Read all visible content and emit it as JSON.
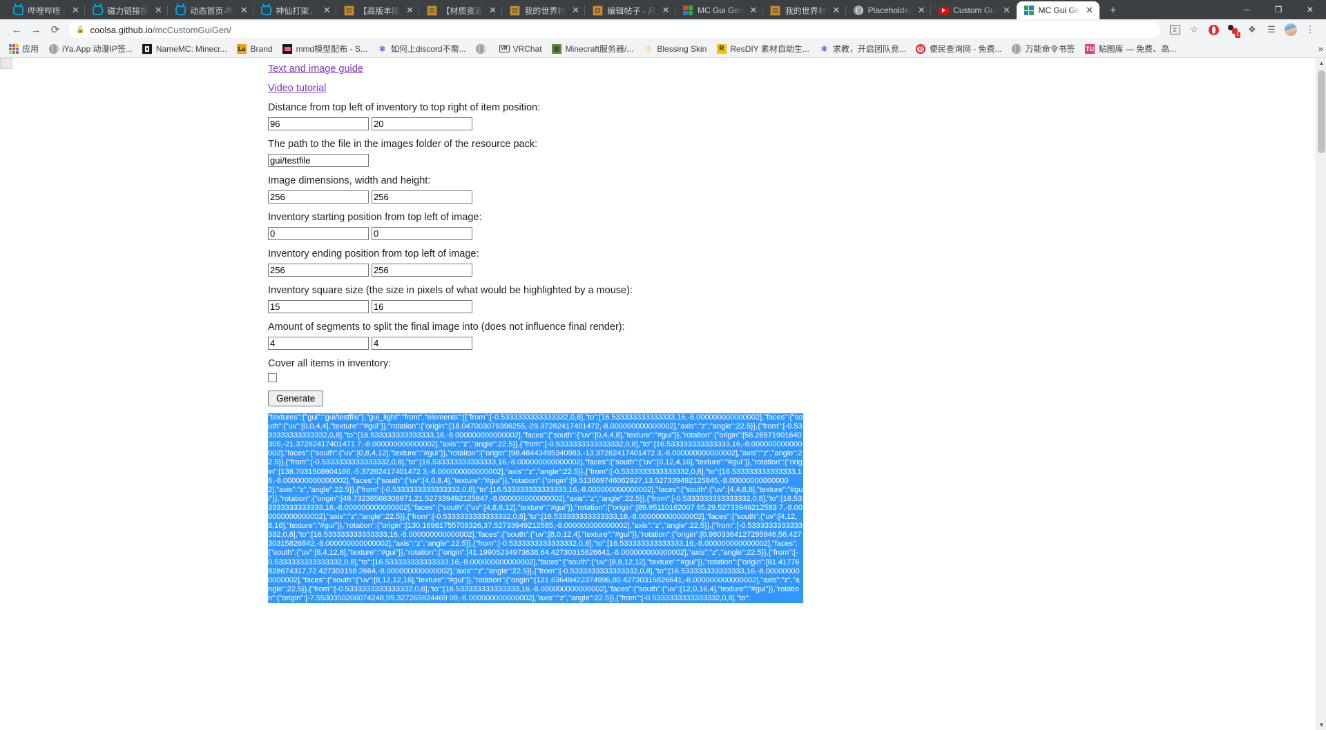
{
  "browser": {
    "tabs": [
      {
        "title": "哔哩哔哩 (",
        "icon": "bilibili-icon",
        "active": false
      },
      {
        "title": "磁力链接搜",
        "icon": "bilibili-icon",
        "active": false
      },
      {
        "title": "动态首页-哔",
        "icon": "bilibili-icon",
        "active": false
      },
      {
        "title": "神仙打架，",
        "icon": "bilibili-icon",
        "active": false
      },
      {
        "title": "【高版本随",
        "icon": "minecraft-crate-icon",
        "active": false
      },
      {
        "title": "【材质资源",
        "icon": "minecraft-crate-icon",
        "active": false
      },
      {
        "title": "我的世界材",
        "icon": "minecraft-crate-icon",
        "active": false
      },
      {
        "title": "编辑帖子 - 月",
        "icon": "minecraft-crate-icon",
        "active": false
      },
      {
        "title": "MC Gui Gen",
        "icon": "mcgui-icon",
        "active": false
      },
      {
        "title": "我的世界材",
        "icon": "minecraft-crate-icon",
        "active": false
      },
      {
        "title": "Placeholder",
        "icon": "globe-icon",
        "active": false
      },
      {
        "title": "Custom Gui",
        "icon": "youtube-icon",
        "active": false
      },
      {
        "title": "MC Gui Ge",
        "icon": "mcgui-icon",
        "active": true
      }
    ],
    "new_tab_label": "+",
    "window_controls": {
      "minimize": "─",
      "maximize": "❐",
      "close": "✕"
    },
    "nav": {
      "back": "←",
      "forward": "→",
      "reload": "⟳"
    },
    "omnibox": {
      "lock_icon": "lock-icon",
      "url_domain": "coolsa.github.io",
      "url_path": "/mcCustomGuiGen/"
    },
    "toolbar_icons": [
      {
        "name": "translate-icon",
        "glyph": "文"
      },
      {
        "name": "bookmark-star-icon",
        "glyph": "☆"
      },
      {
        "name": "opera-extension-icon",
        "glyph": ""
      },
      {
        "name": "adblock-icon",
        "glyph": "",
        "badge": "2"
      },
      {
        "name": "extensions-puzzle-icon",
        "glyph": "❖"
      },
      {
        "name": "playlist-icon",
        "glyph": "☰"
      },
      {
        "name": "profile-avatar",
        "glyph": ""
      },
      {
        "name": "chrome-menu-icon",
        "glyph": "⋮"
      }
    ],
    "bookmarks": [
      {
        "label": "应用",
        "icon": "apps-grid-icon"
      },
      {
        "label": "iYa.App 动漫IP签...",
        "icon": "globe-icon"
      },
      {
        "label": "NameMC: Minecr...",
        "icon": "namemc-icon"
      },
      {
        "label": "Brand",
        "icon": "la-icon"
      },
      {
        "label": "mmd模型配布 - S...",
        "icon": "mmd-icon"
      },
      {
        "label": "如何上discord不需...",
        "icon": "baidu-icon"
      },
      {
        "label": "",
        "icon": "globe-icon"
      },
      {
        "label": "VRChat",
        "icon": "vr-icon"
      },
      {
        "label": "Minecraft服务器/...",
        "icon": "minecraft-server-icon"
      },
      {
        "label": "Blessing Skin",
        "icon": "crown-icon"
      },
      {
        "label": "ResDIY 素材自助生...",
        "icon": "resdiy-icon"
      },
      {
        "label": "求教，开启团队竞...",
        "icon": "baidu-icon"
      },
      {
        "label": "便民查询网 - 免费...",
        "icon": "red-circle-icon"
      },
      {
        "label": "万能命令书签",
        "icon": "globe-icon"
      },
      {
        "label": "贴图库 — 免费、高...",
        "icon": "tuku-icon"
      }
    ],
    "bookmarks_overflow": "»"
  },
  "page": {
    "links": [
      {
        "label": "Text and image guide"
      },
      {
        "label": "Video tutorial"
      }
    ],
    "fields": [
      {
        "label": "Distance from top left of inventory to top right of item position:",
        "inputs": [
          "96",
          "20"
        ]
      },
      {
        "label": "The path to the file in the images folder of the resource pack:",
        "inputs": [
          "gui/testfile"
        ]
      },
      {
        "label": "Image dimensions, width and height:",
        "inputs": [
          "256",
          "256"
        ]
      },
      {
        "label": "Inventory starting position from top left of image:",
        "inputs": [
          "0",
          "0"
        ]
      },
      {
        "label": "Inventory ending position from top left of image:",
        "inputs": [
          "256",
          "256"
        ]
      },
      {
        "label": "Inventory square size (the size in pixels of what would be highlighted by a mouse):",
        "inputs": [
          "15",
          "16"
        ]
      },
      {
        "label": "Amount of segments to split the final image into (does not influence final render):",
        "inputs": [
          "4",
          "4"
        ]
      }
    ],
    "checkbox_label": "Cover all items in inventory:",
    "checkbox_checked": false,
    "generate_button": "Generate",
    "output_selected": true,
    "output_text": "\"textures\":{\"gui\":\"gui/testfile\"},\"gui_light\":\"front\",\"elements\":[{\"from\":[-0.5333333333333332,0,8],\"to\":[16.533333333333333,16,-8.000000000000002],\"faces\":{\"south\":{\"uv\":[0,0,4,4],\"texture\":\"#gui\"}},\"rotation\":{\"origin\":[18.047003079396255,-29.37262417401472,-8.000000000000002],\"axis\":\"z\",\"angle\":22.5}},{\"from\":[-0.5333333333333332,0,8],\"to\":[16.533333333333333,16,-8.000000000000002],\"faces\":{\"south\":{\"uv\":[0,4,4,8],\"texture\":\"#gui\"}},\"rotation\":{\"origin\":[58.26571901640305,-21.37262417401471 7,-8.000000000000002],\"axis\":\"z\",\"angle\":22.5}},{\"from\":[-0.5333333333333332,0,8],\"to\":[16.533333333333333,16,-8.000000000000002],\"faces\":{\"south\":{\"uv\":[0,8,4,12],\"texture\":\"#gui\"}},\"rotation\":{\"origin\":[98.48443495340983,-13.37262417401472 3,-8.000000000000002],\"axis\":\"z\",\"angle\":22.5}},{\"from\":[-0.5333333333333332,0,8],\"to\":[16.533333333333333,16,-8.000000000000002],\"faces\":{\"south\":{\"uv\":[0,12,4,16],\"texture\":\"#gui\"}},\"rotation\":{\"origin\":[138.7031508904166,-5.37262417401472 3,-8.000000000000002],\"axis\":\"z\",\"angle\":22.5}},{\"from\":[-0.5333333333333332,0,8],\"to\":[16.533333333333333,16,-8.000000000000002],\"faces\":{\"south\":{\"uv\":[4,0,8,4],\"texture\":\"#gui\"}},\"rotation\":{\"origin\":[9.513669746062927,13.527339492125845,-8.000000000000002],\"axis\":\"z\",\"angle\":22.5}},{\"from\":[-0.5333333333333332,0,8],\"to\":[16.533333333333333,16,-8.000000000000002],\"faces\":{\"south\":{\"uv\":[4,4,8,8],\"texture\":\"#gui\"}},\"rotation\":{\"origin\":[49.73238568306971,21.527339492125847,-8.000000000000002],\"axis\":\"z\",\"angle\":22.5}},{\"from\":[-0.5333333333333332,0,8],\"to\":[16.533333333333333,16,-8.000000000000002],\"faces\":{\"south\":{\"uv\":[4,8,8,12],\"texture\":\"#gui\"}},\"rotation\":{\"origin\":[89.95110162007 65,29.52733949212583 7,-8.000000000000002],\"axis\":\"z\",\"angle\":22.5}},{\"from\":[-0.5333333333333332,0,8],\"to\":[16.533333333333333,16,-8.000000000000002],\"faces\":{\"south\":{\"uv\":[4,12,8,16],\"texture\":\"#gui\"}},\"rotation\":{\"origin\":[130.16981755708326,37.52733949212585,-8.000000000000002],\"axis\":\"z\",\"angle\":22.5}},{\"from\":[-0.5333333333333332,0,8],\"to\":[16.533333333333333,16,-8.000000000000002],\"faces\":{\"south\":{\"uv\":[8,0,12,4],\"texture\":\"#gui\"}},\"rotation\":{\"origin\":[0.9803364127295946,56.42730315826642,-8.000000000000002],\"axis\":\"z\",\"angle\":22.5}},{\"from\":[-0.5333333333333332,0,8],\"to\":[16.533333333333333,16,-8.000000000000002],\"faces\":{\"south\":{\"uv\":[8,4,12,8],\"texture\":\"#gui\"}},\"rotation\":{\"origin\":[41.19905234973638,64.42730315826641,-8.000000000000002],\"axis\":\"z\",\"angle\":22.5}},{\"from\":[-0.5333333333333332,0,8],\"to\":[16.533333333333333,16,-8.000000000000002],\"faces\":{\"south\":{\"uv\":[8,8,12,12],\"texture\":\"#gui\"}},\"rotation\":{\"origin\":[81.41776828674317,72.427303158 2664,-8.000000000000002],\"axis\":\"z\",\"angle\":22.5}},{\"from\":[-0.5333333333333332,0,8],\"to\":[16.533333333333333,16,-8.000000000000002],\"faces\":{\"south\":{\"uv\":[8,12,12,16],\"texture\":\"#gui\"}},\"rotation\":{\"origin\":[121.63648422374996,80.42730315826641,-8.000000000000002],\"axis\":\"z\",\"angle\":22.5}},{\"from\":[-0.5333333333333332,0,8],\"to\":[16.533333333333333,16,-8.000000000000002],\"faces\":{\"south\":{\"uv\":[12,0,16,4],\"texture\":\"#gui\"}},\"rotation\":{\"origin\":[-7.5530350206074248,99.327265924469 09,-8.000000000000002],\"axis\":\"z\",\"angle\":22.5}},{\"from\":[-0.5333333333333332,0,8],\"to\":"
  },
  "scrollbar": {
    "up_arrow": "▲",
    "down_arrow": "▼"
  },
  "colors": {
    "selection_blue": "#3297fd",
    "link_purple": "#7b2fbe",
    "chrome_dark": "#3c4043",
    "toolbar_grey": "#f1f3f4"
  }
}
